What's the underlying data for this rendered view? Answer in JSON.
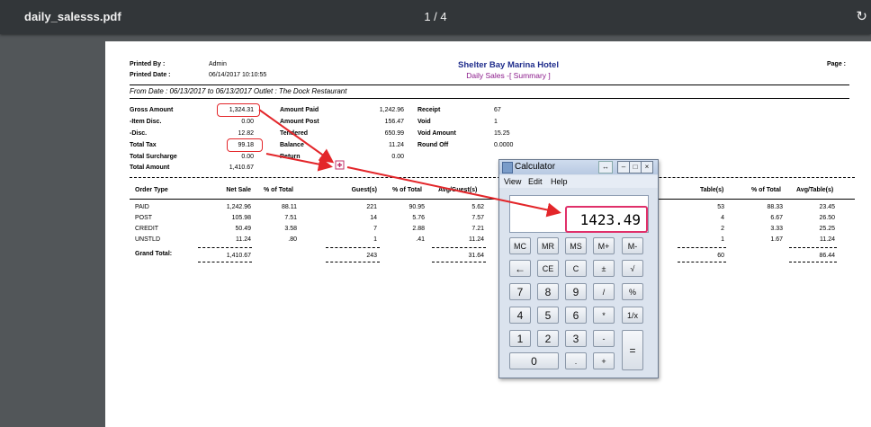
{
  "viewer": {
    "file_name": "daily_salesss.pdf",
    "page_indicator": "1  /  4",
    "rotate_icon": "↻"
  },
  "report": {
    "printed_by_label": "Printed By :",
    "printed_by": "Admin",
    "printed_date_label": "Printed Date :",
    "printed_date": "06/14/2017 10:10:55",
    "hotel": "Shelter Bay Marina Hotel",
    "subtitle": "Daily Sales -[ Summary ]",
    "page_label": "Page :",
    "from_line": "From Date : 06/13/2017 to 06/13/2017 Outlet : The Dock Restaurant",
    "summary_col1": [
      {
        "label": "Gross Amount",
        "value": "1,324.31"
      },
      {
        "label": "-Item Disc.",
        "value": "0.00"
      },
      {
        "label": "-Disc.",
        "value": "12.82"
      },
      {
        "label": "Total Tax",
        "value": "99.18"
      },
      {
        "label": "Total Surcharge",
        "value": "0.00"
      },
      {
        "label": "Total Amount",
        "value": "1,410.67"
      }
    ],
    "summary_col2": [
      {
        "label": "Amount Paid",
        "value": "1,242.96"
      },
      {
        "label": "Amount Post",
        "value": "156.47"
      },
      {
        "label": "Tendered",
        "value": "650.99"
      },
      {
        "label": "Balance",
        "value": "11.24"
      },
      {
        "label": "Return",
        "value": "0.00"
      }
    ],
    "summary_col3": [
      {
        "label": "Receipt",
        "value": "67"
      },
      {
        "label": "Void",
        "value": "1"
      },
      {
        "label": "Void Amount",
        "value": "15.25"
      },
      {
        "label": "Round Off",
        "value": "0.0000"
      }
    ],
    "table_headers": [
      "Order Type",
      "Net Sale",
      "% of Total",
      "Guest(s)",
      "% of Total",
      "Avg/Guest(s)",
      "Table(s)",
      "% of Total",
      "Avg/Table(s)"
    ],
    "rows": [
      {
        "type": "PAID",
        "net": "1,242.96",
        "pct": "88.11",
        "guests": "221",
        "gpct": "90.95",
        "avg": "5.62",
        "tables": "53",
        "tpct": "88.33",
        "tavg": "23.45"
      },
      {
        "type": "POST",
        "net": "105.98",
        "pct": "7.51",
        "guests": "14",
        "gpct": "5.76",
        "avg": "7.57",
        "tables": "4",
        "tpct": "6.67",
        "tavg": "26.50"
      },
      {
        "type": "CREDIT",
        "net": "50.49",
        "pct": "3.58",
        "guests": "7",
        "gpct": "2.88",
        "avg": "7.21",
        "tables": "2",
        "tpct": "3.33",
        "tavg": "25.25"
      },
      {
        "type": "UNSTLD",
        "net": "11.24",
        "pct": ".80",
        "guests": "1",
        "gpct": ".41",
        "avg": "11.24",
        "tables": "1",
        "tpct": "1.67",
        "tavg": "11.24"
      }
    ],
    "grand_total": {
      "label": "Grand Total:",
      "net": "1,410.67",
      "guests": "243",
      "avg": "31.64",
      "tables": "60",
      "tavg": "86.44"
    }
  },
  "calculator": {
    "title": "Calculator",
    "menu": [
      "View",
      "Edit",
      "Help"
    ],
    "display": "1423.49",
    "keys": [
      "MC",
      "MR",
      "MS",
      "M+",
      "M-",
      "←",
      "CE",
      "C",
      "±",
      "√",
      "7",
      "8",
      "9",
      "/",
      "%",
      "4",
      "5",
      "6",
      "*",
      "1/x",
      "1",
      "2",
      "3",
      "-",
      "=",
      "0",
      ".",
      "+"
    ]
  },
  "colors": {
    "highlight": "#e3262a",
    "display_highlight": "#e0306a",
    "hotel": "#1f2d8c",
    "subtitle": "#8b1a8b"
  }
}
